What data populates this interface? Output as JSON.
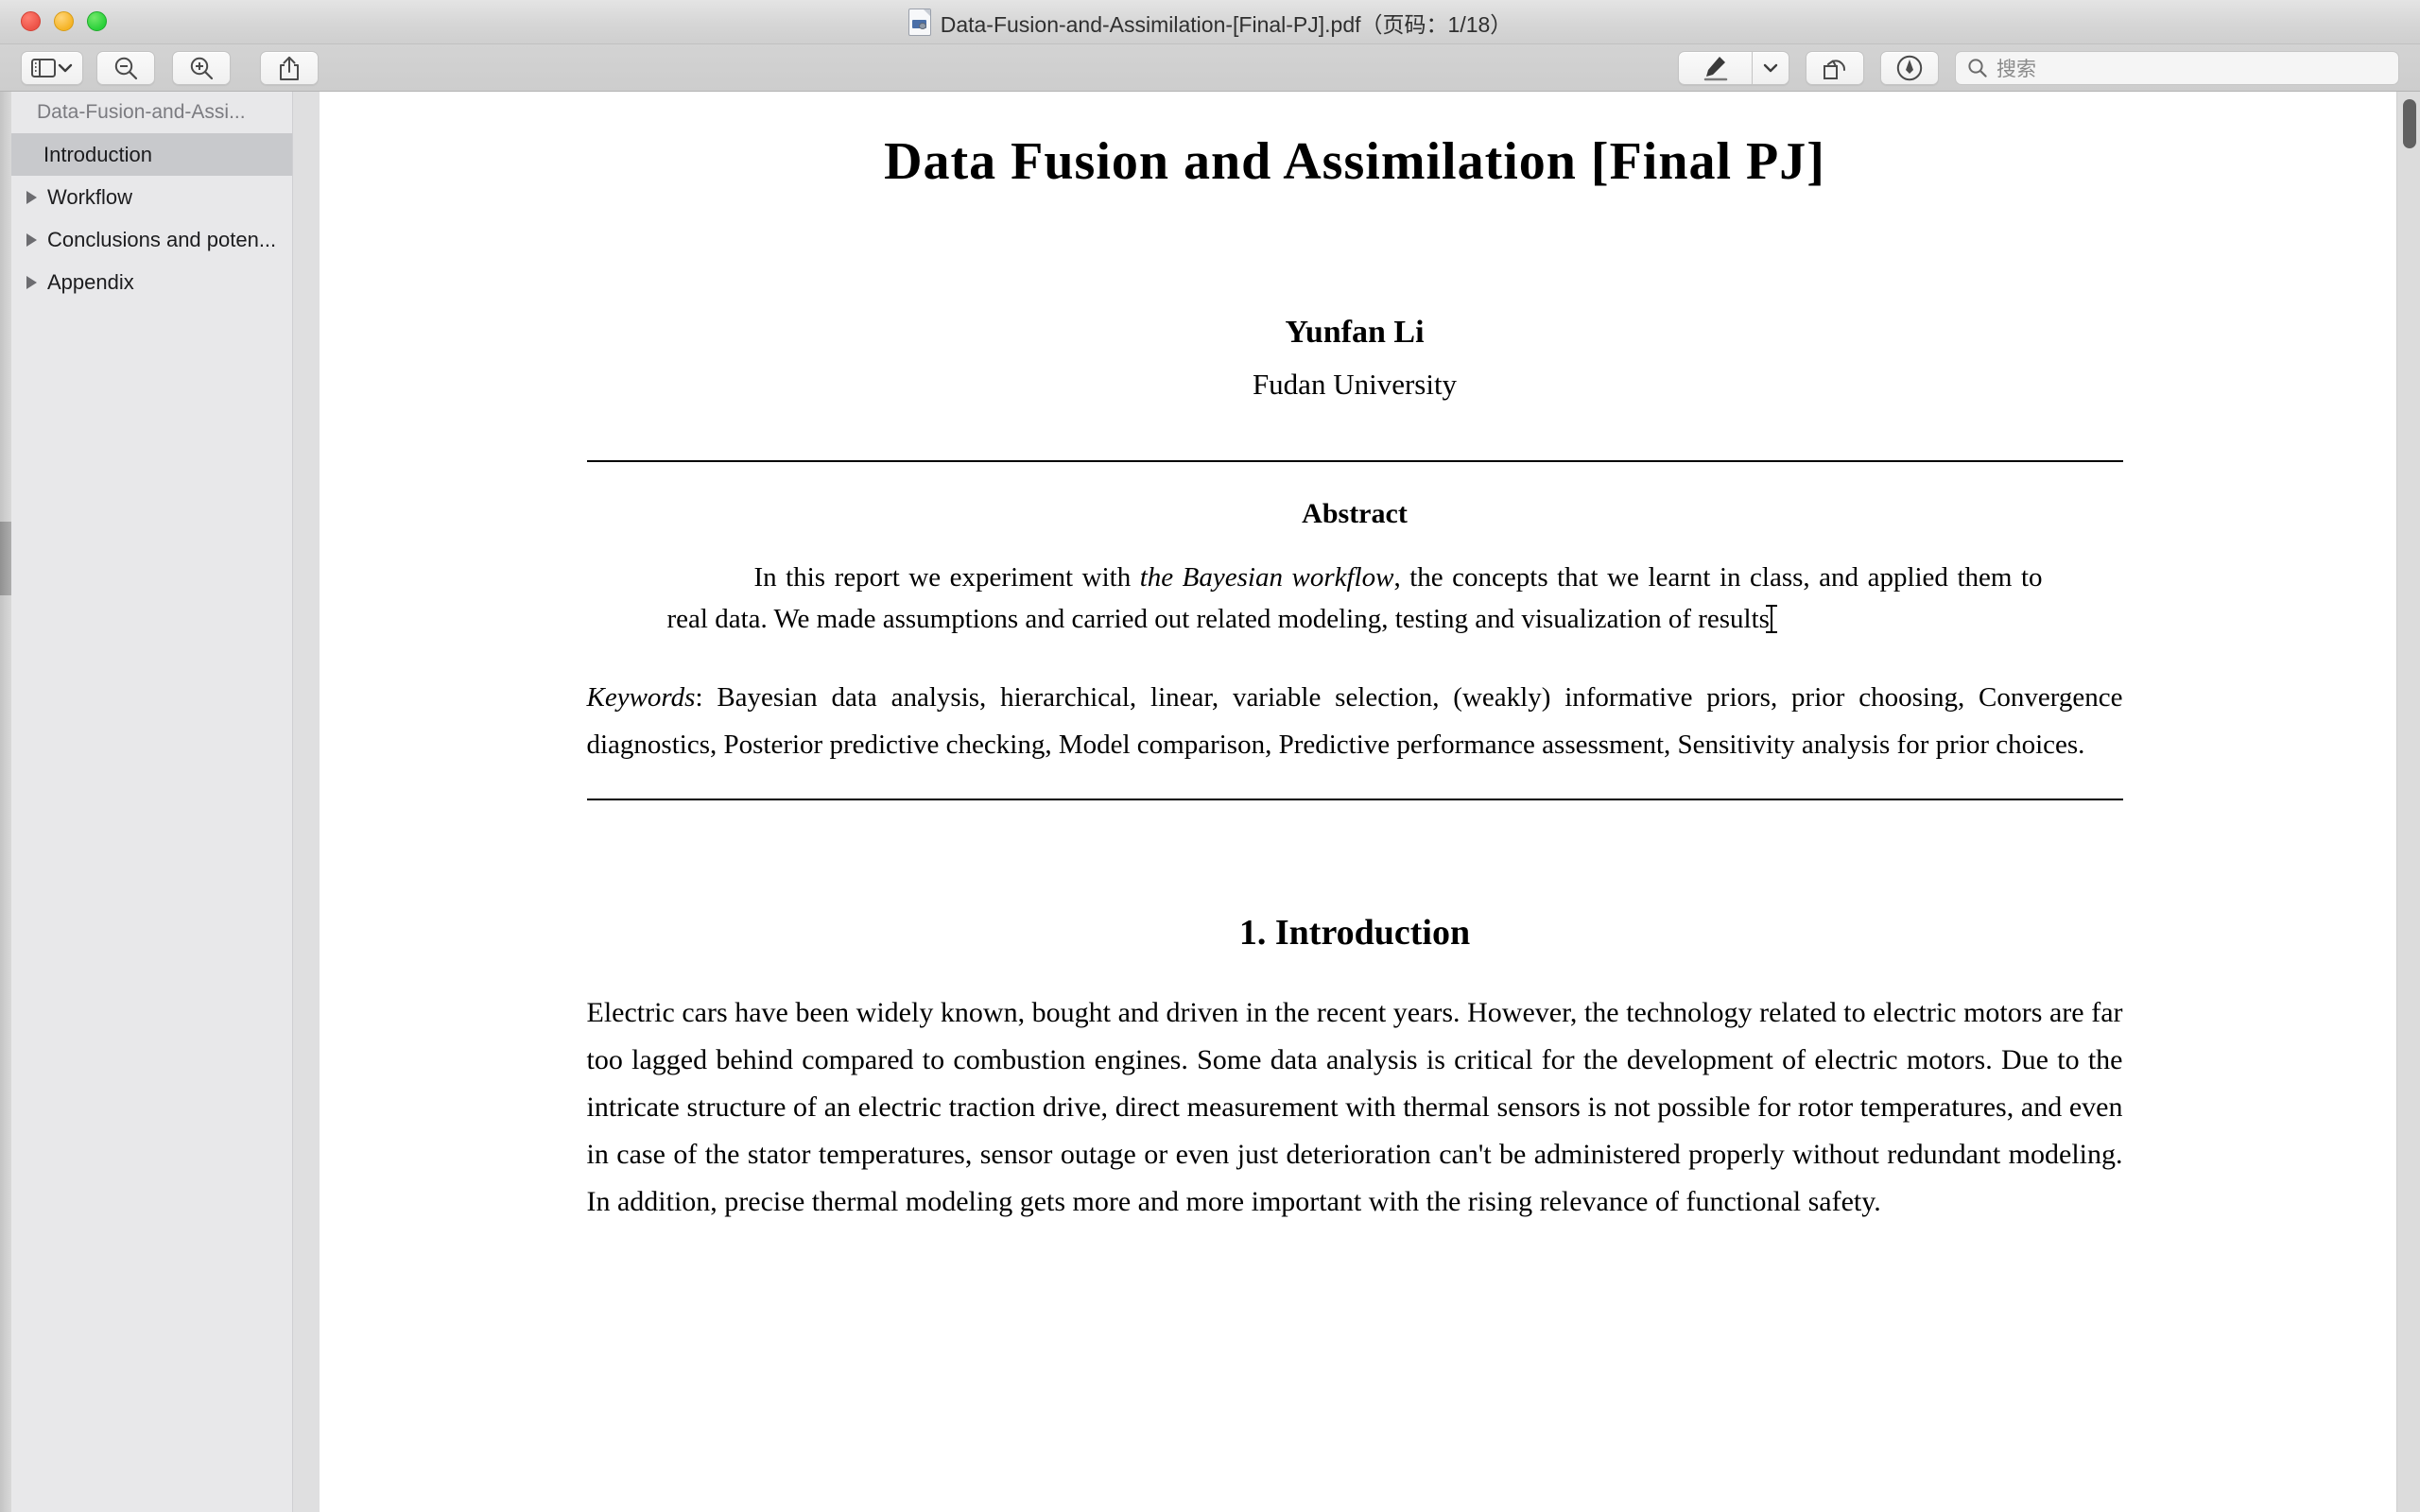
{
  "window": {
    "title": "Data-Fusion-and-Assimilation-[Final-PJ].pdf（页码：1/18）",
    "traffic_lights": {
      "close": "close-button",
      "minimize": "minimize-button",
      "maximize": "maximize-button"
    }
  },
  "toolbar": {
    "sidebar_toggle": "sidebar-view-toggle",
    "zoom_out": "zoom-out",
    "zoom_in": "zoom-in",
    "share": "share",
    "highlight": "highlight",
    "highlight_menu": "highlight-options",
    "rotate": "rotate-left",
    "markup": "markup",
    "search_placeholder": "搜索"
  },
  "sidebar": {
    "header": "Data-Fusion-and-Assi...",
    "items": [
      {
        "label": "Introduction",
        "selected": true,
        "expandable": false
      },
      {
        "label": "Workflow",
        "selected": false,
        "expandable": true
      },
      {
        "label": "Conclusions and poten...",
        "selected": false,
        "expandable": true
      },
      {
        "label": "Appendix",
        "selected": false,
        "expandable": true
      }
    ]
  },
  "document": {
    "title": "Data Fusion and Assimilation [Final PJ]",
    "author": "Yunfan Li",
    "affiliation": "Fudan University",
    "abstract_heading": "Abstract",
    "abstract_part1": "In this report we experiment with ",
    "abstract_emphasis": "the Bayesian workflow",
    "abstract_part2": ", the concepts that we learnt in class, and applied them to real data. We made assumptions and carried out related modeling, testing and visualization of results",
    "keywords_label": "Keywords",
    "keywords_text": ": Bayesian data analysis, hierarchical, linear, variable selection, (weakly) informative priors, prior choosing, Convergence diagnostics, Posterior predictive checking, Model comparison, Predictive performance assessment, Sensitivity analysis for prior choices.",
    "section_heading": "1.  Introduction",
    "paragraph_1": "Electric cars have been widely known, bought and driven in the recent years. However, the technology related to electric motors are far too lagged behind compared to combustion engines. Some data analysis is critical for the development of electric motors. Due to the intricate structure of an electric traction drive, direct measurement with thermal sensors is not possible for rotor temperatures, and even in case of the stator temperatures, sensor outage or even just deterioration can't be administered properly without redundant modeling. In addition, precise thermal modeling gets more and more important with the rising relevance of functional safety."
  },
  "colors": {
    "titlebar": "#d6d6d6",
    "toolbar": "#cfcfcf",
    "sidebar": "#e8e8ea",
    "sidebar_selected": "#c8c9cc",
    "page": "#ffffff",
    "scrollbar_thumb": "#616161"
  }
}
